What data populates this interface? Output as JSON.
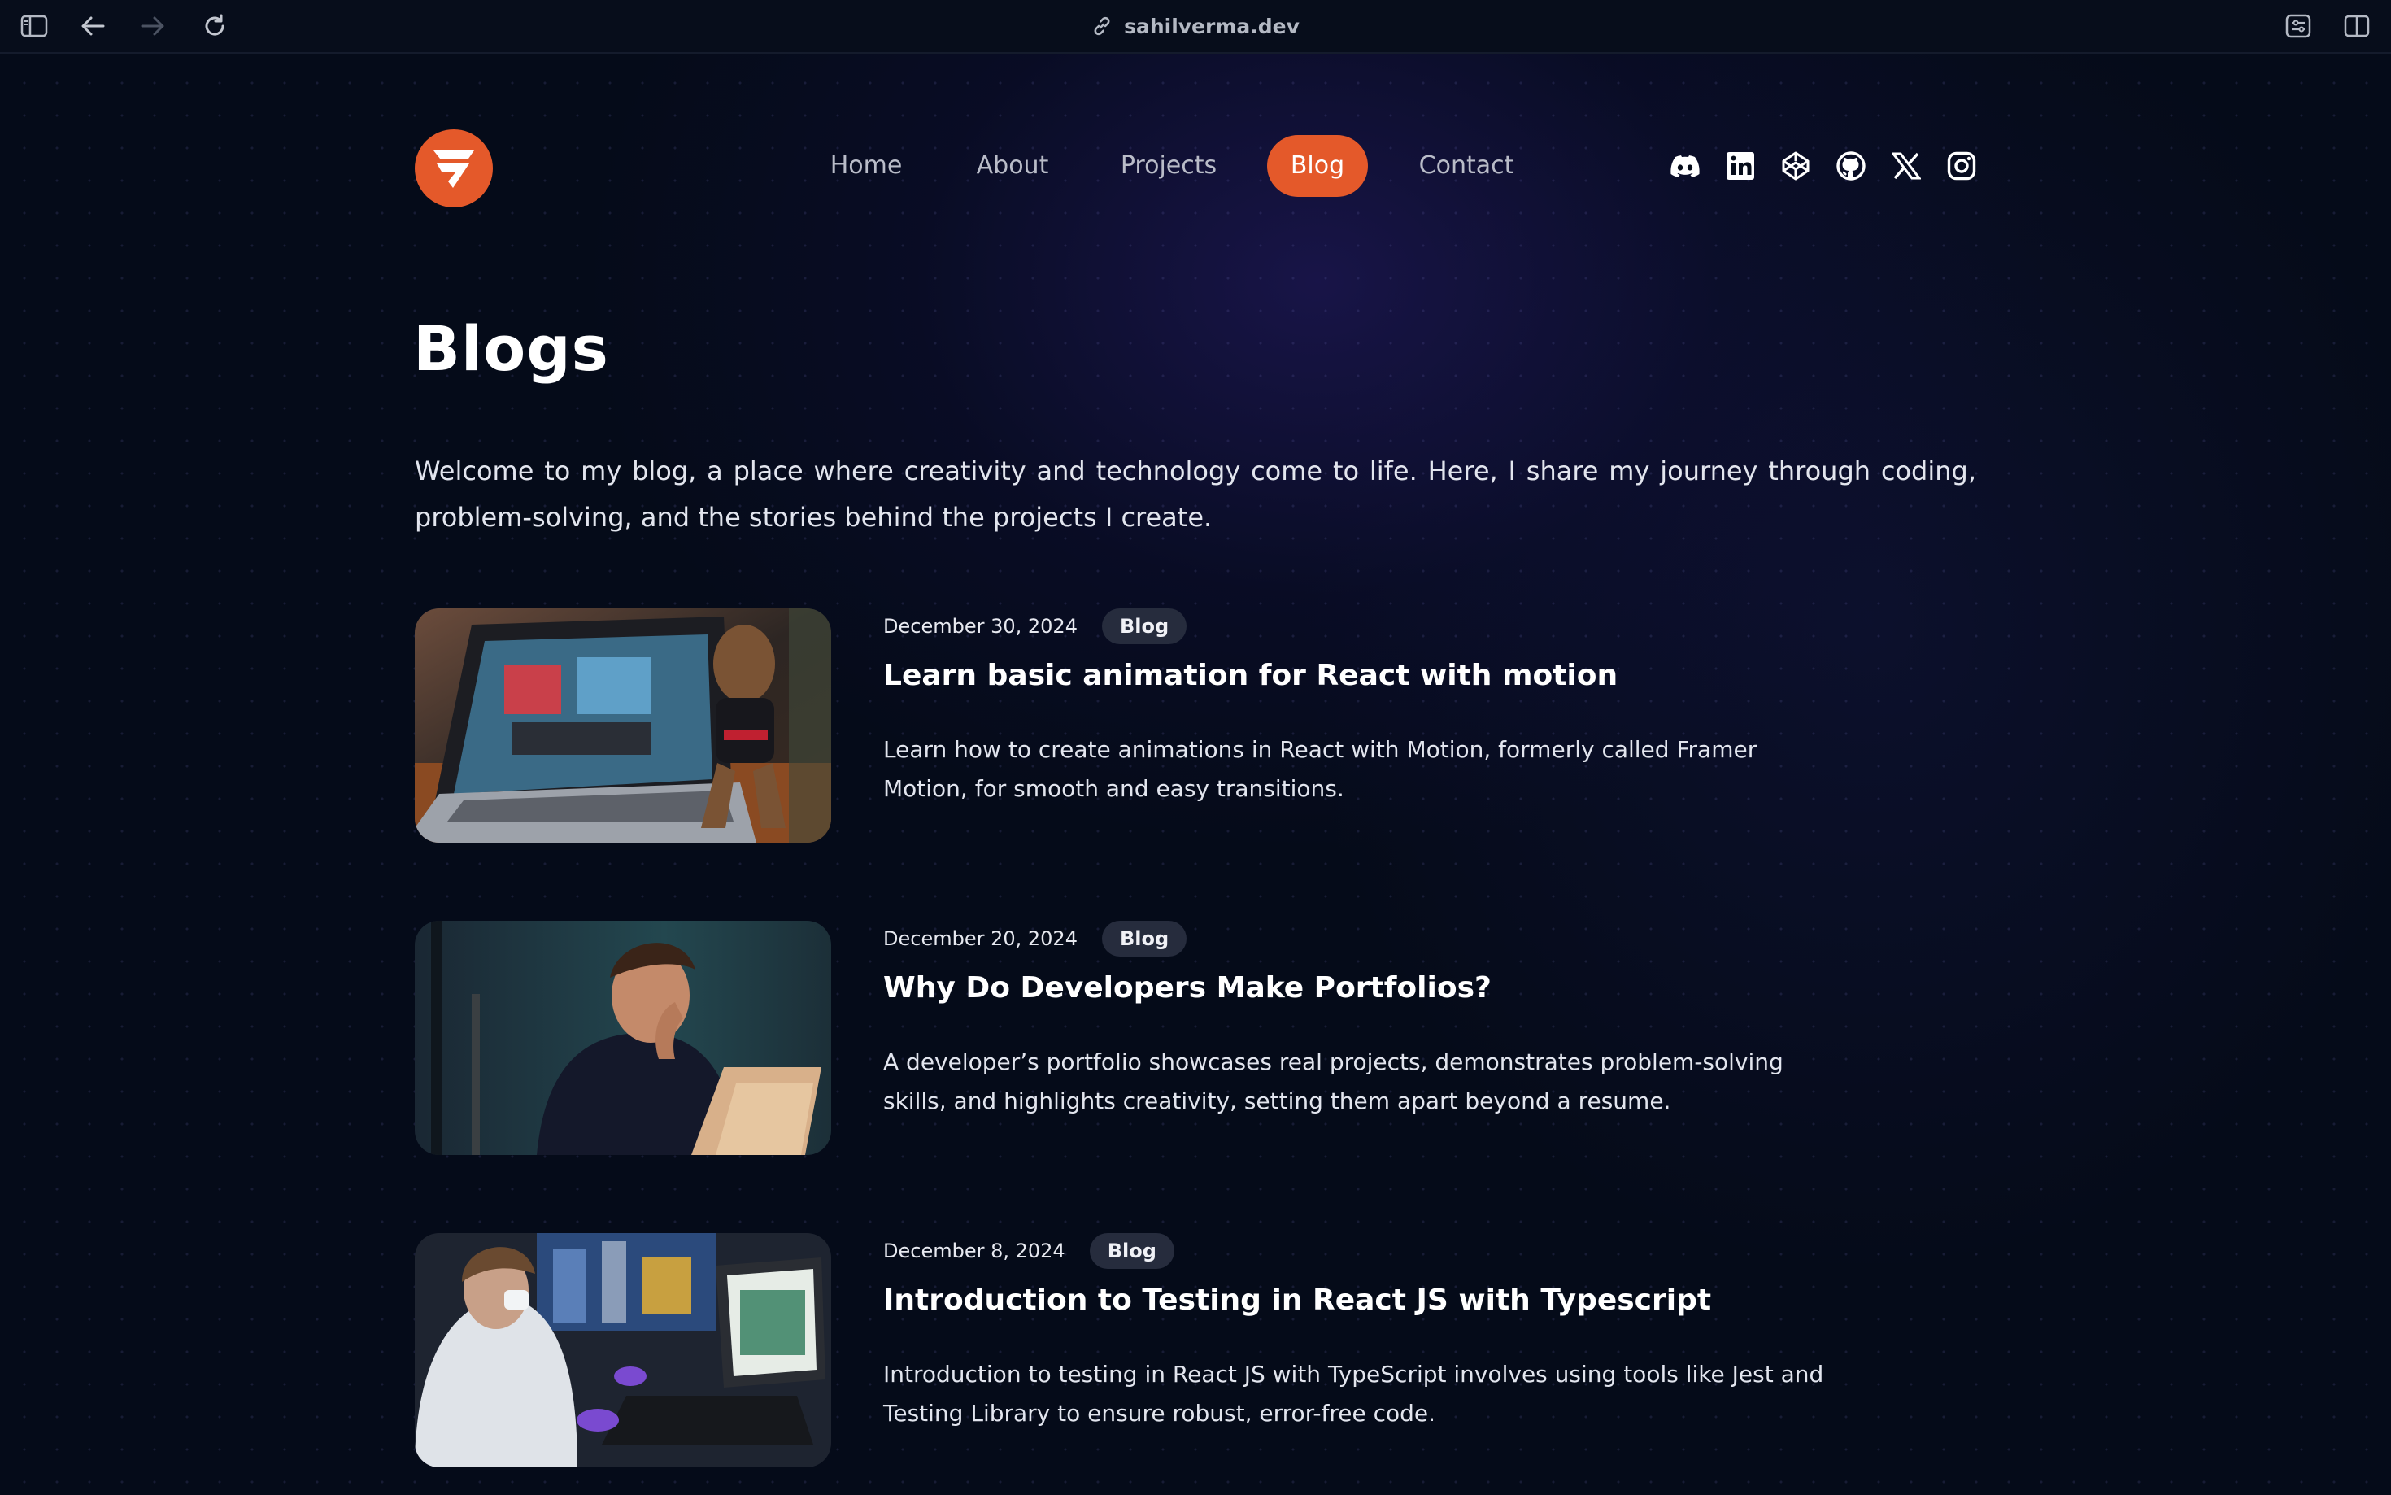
{
  "browser": {
    "url": "sahilverma.dev",
    "icons": [
      "sidebar-icon",
      "back-arrow-icon",
      "forward-arrow-icon",
      "reload-icon",
      "link-icon",
      "reader-settings-icon",
      "split-view-icon"
    ]
  },
  "brand": {
    "accent": "#e4592a",
    "background": "#050b19"
  },
  "nav": {
    "items": [
      {
        "label": "Home"
      },
      {
        "label": "About"
      },
      {
        "label": "Projects"
      },
      {
        "label": "Blog",
        "active": true
      },
      {
        "label": "Contact"
      }
    ]
  },
  "social": [
    "discord-icon",
    "linkedin-icon",
    "codepen-icon",
    "github-icon",
    "x-icon",
    "instagram-icon"
  ],
  "main": {
    "title": "Blogs",
    "intro": "Welcome to my blog, a place where creativity and technology come to life. Here, I share my journey through coding, problem-solving, and the stories behind the projects I create."
  },
  "posts": [
    {
      "date": "December 30, 2024",
      "tag": "Blog",
      "title": "Learn basic animation for React with motion",
      "description": "Learn how to create animations in React with Motion, formerly called Framer Motion, for smooth and easy transitions."
    },
    {
      "date": "December 20, 2024",
      "tag": "Blog",
      "title": "Why Do Developers Make Portfolios?",
      "description": "A developer’s portfolio showcases real projects, demonstrates problem-solving skills, and highlights creativity, setting them apart beyond a resume."
    },
    {
      "date": "December 8, 2024",
      "tag": "Blog",
      "title": "Introduction to Testing in React JS with Typescript",
      "description": "Introduction to testing in React JS with TypeScript involves using tools like Jest and Testing Library to ensure robust, error-free code."
    }
  ]
}
